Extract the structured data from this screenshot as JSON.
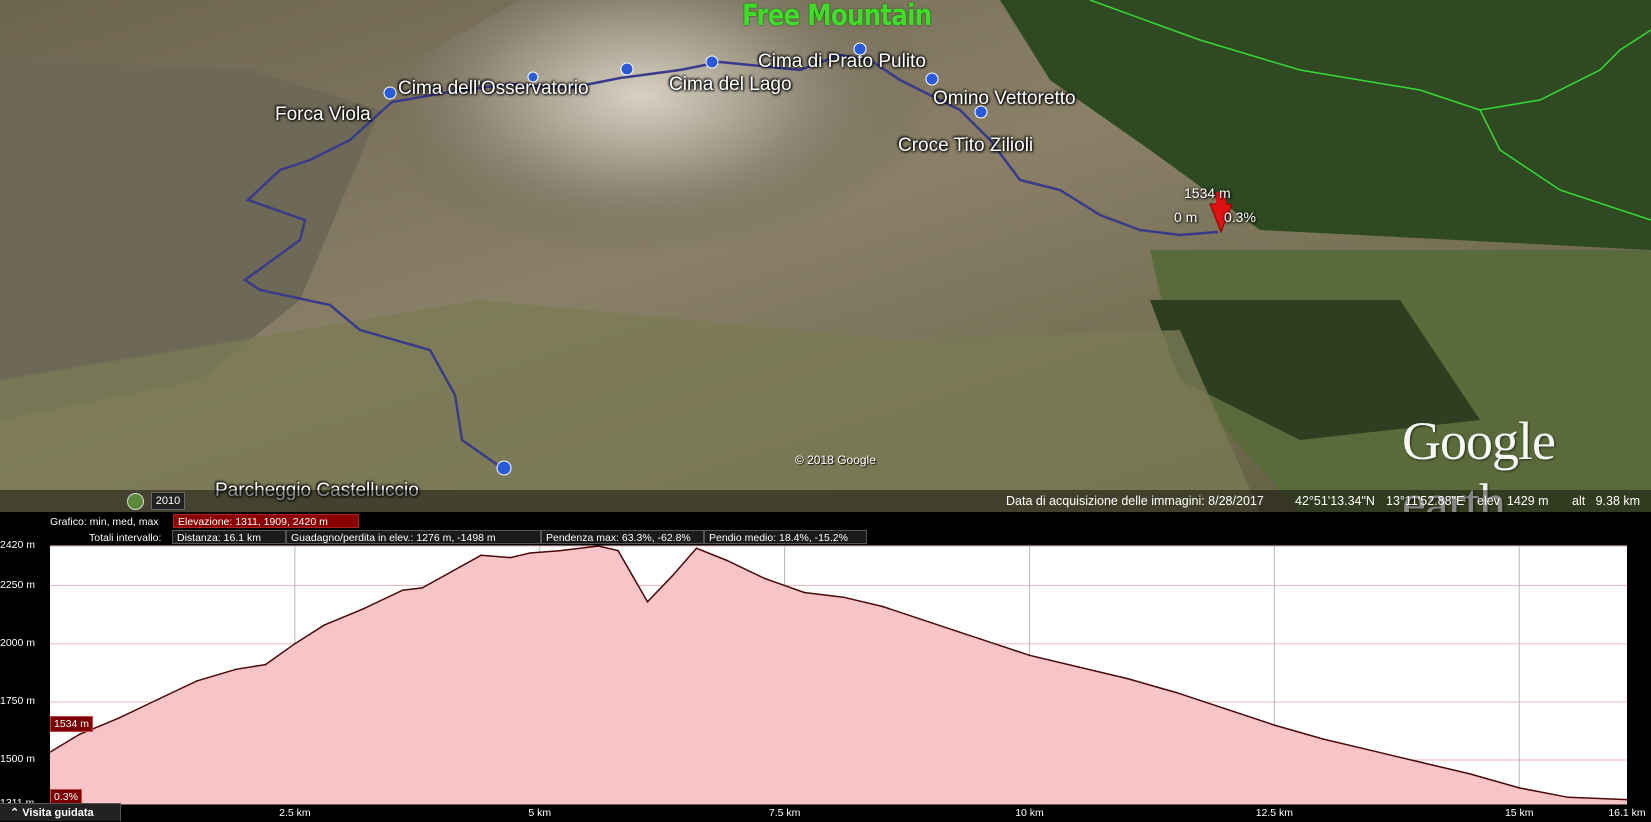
{
  "brand": "Free Mountain",
  "placemarks": [
    {
      "label": "Cima dell'Osservatorio"
    },
    {
      "label": "Forca Viola"
    },
    {
      "label": "Cima del Lago"
    },
    {
      "label": "Cima di Prato Pulito"
    },
    {
      "label": "Omino Vettoretto"
    },
    {
      "label": "Croce Tito Zilioli"
    },
    {
      "label": "Parcheggio Castelluccio"
    }
  ],
  "cursor": {
    "elevation": "1534 m",
    "distance": "0 m",
    "slope": "0.3%"
  },
  "copyright": "© 2018 Google",
  "logo": "Google earth",
  "historical_year": "2010",
  "status": {
    "imagery_date": "Data di acquisizione delle immagini: 8/28/2017",
    "lat": "42°51'13.34\"N",
    "lon": "13°11'52.88\"E",
    "elev": "elev  1429 m",
    "alt": "alt   9.38 km"
  },
  "profile_info": {
    "graph_label": "Grafico: min, med, max",
    "elevation_box": "Elevazione: 1311, 1909, 2420 m",
    "totals_label": "Totali intervallo:",
    "distance_box": "Distanza: 16.1 km",
    "gain_box": "Guadagno/perdita in elev.: 1276 m, -1498 m",
    "slope_max_box": "Pendenza max: 63.3%, -62.8%",
    "slope_avg_box": "Pendio medio: 18.4%, -15.2%"
  },
  "tour_button": "Visita guidata",
  "chart_data": {
    "type": "area",
    "xlabel": "",
    "ylabel": "",
    "x_ticks": [
      "2.5 km",
      "5 km",
      "7.5 km",
      "10 km",
      "12.5 km",
      "15 km",
      "16.1 km"
    ],
    "y_ticks": [
      "2420 m",
      "2250 m",
      "2000 m",
      "1750 m",
      "1500 m",
      "1311 m"
    ],
    "xlim": [
      0,
      16.1
    ],
    "ylim": [
      1311,
      2420
    ],
    "current_value_tag": "1534 m",
    "current_slope_tag": "0.3%",
    "series": [
      {
        "x": [
          0,
          0.3,
          0.7,
          1.1,
          1.5,
          1.9,
          2.2,
          2.5,
          2.8,
          3.2,
          3.6,
          3.8,
          4.1,
          4.4,
          4.7,
          4.9,
          5.2,
          5.6,
          5.8,
          6.1,
          6.35,
          6.6,
          6.9,
          7.3,
          7.7,
          8.1,
          8.5,
          9.0,
          9.5,
          10.0,
          10.5,
          11.0,
          11.5,
          12.0,
          12.5,
          13.0,
          13.5,
          14.0,
          14.5,
          15.0,
          15.5,
          16.1
        ],
        "y": [
          1534,
          1610,
          1680,
          1760,
          1840,
          1890,
          1910,
          2000,
          2080,
          2150,
          2230,
          2240,
          2310,
          2380,
          2370,
          2390,
          2400,
          2420,
          2400,
          2180,
          2290,
          2410,
          2360,
          2280,
          2220,
          2200,
          2160,
          2090,
          2020,
          1950,
          1900,
          1850,
          1790,
          1720,
          1650,
          1590,
          1540,
          1490,
          1440,
          1380,
          1340,
          1330
        ]
      }
    ],
    "fill_color": "#f7c4c8",
    "line_color": "#4a0a0a",
    "grid": true
  }
}
